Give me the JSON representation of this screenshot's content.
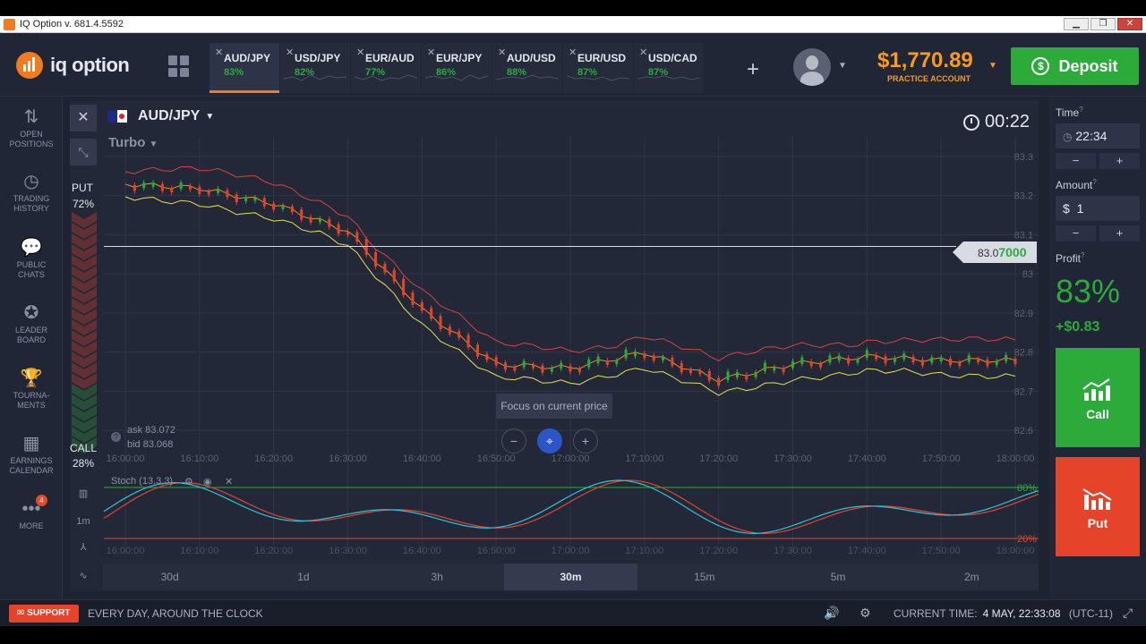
{
  "window": {
    "title": "IQ Option v. 681.4.5592"
  },
  "header": {
    "logo_text": "iq option",
    "balance": "$1,770.89",
    "account_type": "PRACTICE ACCOUNT",
    "deposit_label": "Deposit",
    "tabs": [
      {
        "name": "AUD/JPY",
        "pct": "83%",
        "active": true
      },
      {
        "name": "USD/JPY",
        "pct": "82%",
        "active": false
      },
      {
        "name": "EUR/AUD",
        "pct": "77%",
        "active": false
      },
      {
        "name": "EUR/JPY",
        "pct": "86%",
        "active": false
      },
      {
        "name": "AUD/USD",
        "pct": "88%",
        "active": false
      },
      {
        "name": "EUR/USD",
        "pct": "87%",
        "active": false
      },
      {
        "name": "USD/CAD",
        "pct": "87%",
        "active": false
      }
    ]
  },
  "sidebar": {
    "items": [
      {
        "label": "OPEN\nPOSITIONS",
        "icon": "arrows-updown-icon"
      },
      {
        "label": "TRADING\nHISTORY",
        "icon": "history-icon"
      },
      {
        "label": "PUBLIC\nCHATS",
        "icon": "chat-icon"
      },
      {
        "label": "LEADER\nBOARD",
        "icon": "leaderboard-icon"
      },
      {
        "label": "TOURNA-\nMENTS",
        "icon": "trophy-icon"
      },
      {
        "label": "EARNINGS\nCALENDAR",
        "icon": "calendar-icon"
      },
      {
        "label": "MORE",
        "icon": "more-icon"
      }
    ],
    "more_badge": "4"
  },
  "chart": {
    "asset": "AUD/JPY",
    "mode": "Turbo",
    "timer": "00:22",
    "put_label": "PUT",
    "put_pct": "72%",
    "call_label": "CALL",
    "call_pct": "28%",
    "ask": "ask 83.072",
    "bid": "bid 83.068",
    "current_price_prefix": "83.0",
    "current_price_suffix": "7000",
    "focus_tooltip": "Focus on current price",
    "stoch_label": "Stoch (13,3,3)",
    "stoch_high": "80%",
    "stoch_low": "20%",
    "side_tf": "1m",
    "y_ticks": [
      "83.3",
      "83.2",
      "83.1",
      "83",
      "82.9",
      "82.8",
      "82.7",
      "82.6"
    ],
    "x_ticks": [
      "16:00:00",
      "16:10:00",
      "16:20:00",
      "16:30:00",
      "16:40:00",
      "16:50:00",
      "17:00:00",
      "17:10:00",
      "17:20:00",
      "17:30:00",
      "17:40:00",
      "17:50:00",
      "18:00:00"
    ],
    "periods": [
      "30d",
      "1d",
      "3h",
      "30m",
      "15m",
      "5m",
      "2m"
    ],
    "active_period": "30m"
  },
  "chart_data": {
    "type": "line",
    "title": "",
    "xlabel": "",
    "ylabel": "",
    "x": [
      "16:00",
      "16:10",
      "16:20",
      "16:30",
      "16:40",
      "16:50",
      "17:00",
      "17:10",
      "17:20",
      "17:30",
      "17:40",
      "17:50",
      "18:00"
    ],
    "series": [
      {
        "values": [
          83.22,
          83.21,
          83.17,
          83.1,
          82.9,
          82.76,
          82.75,
          82.79,
          82.72,
          82.76,
          82.78,
          82.77,
          82.77
        ]
      }
    ],
    "ylim": [
      82.55,
      83.35
    ]
  },
  "trade": {
    "time_label": "Time",
    "time_value": "22:34",
    "amount_label": "Amount",
    "amount_currency": "$",
    "amount_value": "1",
    "profit_label": "Profit",
    "profit_pct": "83%",
    "profit_amount": "+$0.83",
    "call_label": "Call",
    "put_label": "Put"
  },
  "footer": {
    "support_label": "SUPPORT",
    "slogan": "EVERY DAY, AROUND THE CLOCK",
    "current_time_label": "CURRENT TIME:",
    "current_time_value": "4 MAY, 22:33:08",
    "timezone": "(UTC-11)"
  },
  "colors": {
    "accent": "#f47a1f",
    "green": "#2cab3a",
    "red": "#e6432b",
    "balance": "#f59a23"
  }
}
